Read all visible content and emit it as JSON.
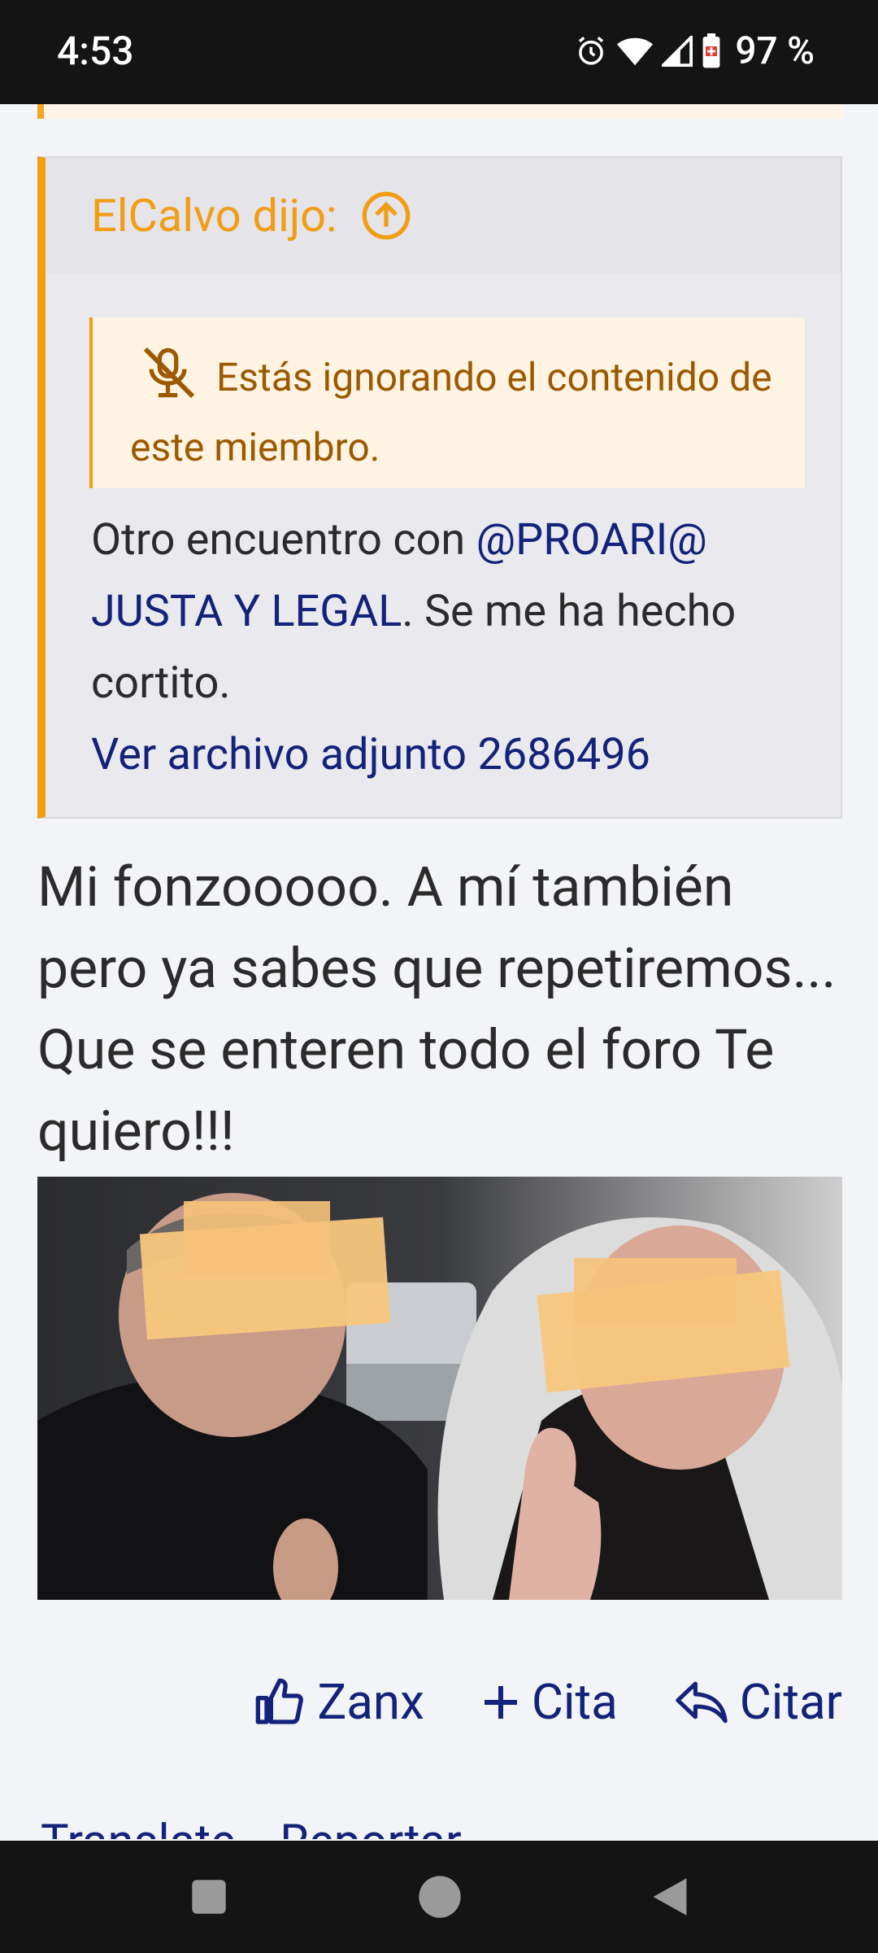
{
  "status_bar": {
    "time": "4:53",
    "battery": "97 %"
  },
  "quote": {
    "author_label": "ElCalvo dijo:",
    "ignored_notice": "Estás ignorando el contenido de este miembro.",
    "body_text_1": "Otro encuentro con ",
    "mention": "@PROARI@ JUSTA Y LEGAL",
    "body_text_2": ". Se me ha hecho cortito.",
    "attachment_link": "Ver archivo adjunto 2686496"
  },
  "reply": {
    "text": "Mi fonzooooo. A mí también pero ya sabes que repetiremos... Que se enteren todo el foro Te quiero!!!"
  },
  "actions": {
    "like_label": "Zanx",
    "multiquote_label": "Cita",
    "quote_label": "Citar"
  },
  "footer_peek": {
    "translate": "Translate",
    "report": "Reportar"
  },
  "colors": {
    "accent_orange": "#f29d16",
    "link_blue": "#13227a",
    "ignored_bg": "#fff3e3",
    "quote_bg": "#e9e9ee"
  },
  "icons": [
    "alarm-icon",
    "wifi-icon",
    "signal-icon",
    "battery-icon",
    "jump-up-icon",
    "mute-icon",
    "thumbs-up-icon",
    "plus-icon",
    "reply-icon",
    "nav-recents-icon",
    "nav-home-icon",
    "nav-back-icon"
  ]
}
